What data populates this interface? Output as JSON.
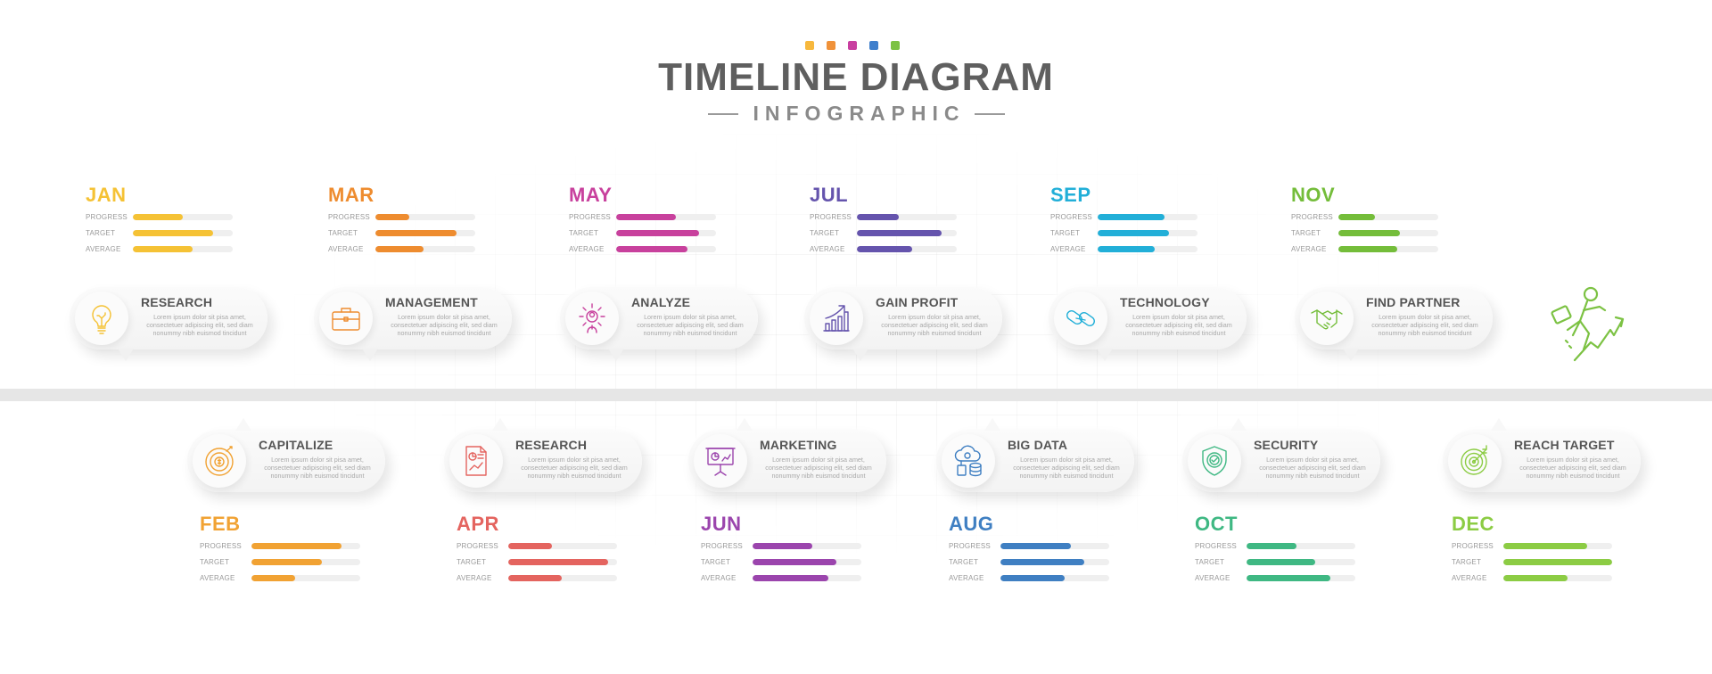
{
  "header": {
    "title": "TIMELINE DIAGRAM",
    "subtitle": "INFOGRAPHIC",
    "dot_colors": [
      "#f7b83d",
      "#f0923a",
      "#c93fa0",
      "#3f7fcc",
      "#7cc243"
    ]
  },
  "labels": {
    "progress": "PROGRESS",
    "target": "TARGET",
    "average": "AVERAGE"
  },
  "description": "Lorem ipsum dolor sit pisa amet, consectetuer adipiscing elit, sed diam nonummy nibh euismod tincidunt",
  "months": [
    {
      "month": "JAN",
      "color": "#f5c235",
      "progress": 50,
      "target": 80,
      "average": 60,
      "card_title": "RESEARCH",
      "icon": "lightbulb-icon"
    },
    {
      "month": "FEB",
      "color": "#f1a233",
      "progress": 83,
      "target": 65,
      "average": 40,
      "card_title": "CAPITALIZE",
      "icon": "coin-target-icon"
    },
    {
      "month": "MAR",
      "color": "#ee8c2f",
      "progress": 34,
      "target": 81,
      "average": 48,
      "card_title": "MANAGEMENT",
      "icon": "briefcase-icon"
    },
    {
      "month": "APR",
      "color": "#e4645f",
      "progress": 40,
      "target": 92,
      "average": 49,
      "card_title": "RESEARCH",
      "icon": "document-chart-icon"
    },
    {
      "month": "MAY",
      "color": "#c8419d",
      "progress": 60,
      "target": 83,
      "average": 71,
      "card_title": "ANALYZE",
      "icon": "gear-person-icon"
    },
    {
      "month": "JUN",
      "color": "#9b45ad",
      "progress": 55,
      "target": 77,
      "average": 70,
      "card_title": "MARKETING",
      "icon": "presentation-icon"
    },
    {
      "month": "JUL",
      "color": "#6554ad",
      "progress": 42,
      "target": 85,
      "average": 55,
      "card_title": "GAIN PROFIT",
      "icon": "growth-chart-icon"
    },
    {
      "month": "AUG",
      "color": "#3f7fc2",
      "progress": 65,
      "target": 77,
      "average": 59,
      "card_title": "BIG DATA",
      "icon": "cloud-database-icon"
    },
    {
      "month": "SEP",
      "color": "#22afd8",
      "progress": 67,
      "target": 71,
      "average": 57,
      "card_title": "TECHNOLOGY",
      "icon": "chain-link-icon"
    },
    {
      "month": "OCT",
      "color": "#3fb883",
      "progress": 46,
      "target": 63,
      "average": 77,
      "card_title": "SECURITY",
      "icon": "shield-check-icon"
    },
    {
      "month": "NOV",
      "color": "#74bd3a",
      "progress": 37,
      "target": 62,
      "average": 59,
      "card_title": "FIND PARTNER",
      "icon": "handshake-icon"
    },
    {
      "month": "DEC",
      "color": "#8ccc44",
      "progress": 77,
      "target": 100,
      "average": 59,
      "card_title": "REACH TARGET",
      "icon": "bullseye-icon"
    }
  ],
  "end_icon": "businessman-running-growth-icon"
}
